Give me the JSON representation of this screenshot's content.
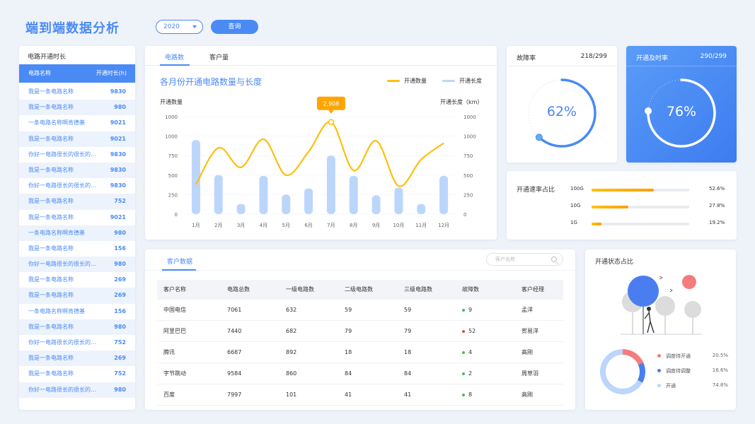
{
  "page": {
    "title": "端到端数据分析",
    "year": "2020",
    "query_label": "查询"
  },
  "left_panel": {
    "title": "电路开通时长",
    "col_name": "电路名称",
    "col_value": "开通时长(h)",
    "rows": [
      {
        "name": "我是一条电路名称",
        "value": "9830"
      },
      {
        "name": "我是一条电路名称",
        "value": "980"
      },
      {
        "name": "一条电路名称啊肯德基",
        "value": "9021"
      },
      {
        "name": "我是一条电路名称",
        "value": "9021"
      },
      {
        "name": "你好一电路很长的很长的...",
        "value": "9830"
      },
      {
        "name": "我是一条电路名称",
        "value": "9830"
      },
      {
        "name": "你好一电路很长的很长的...",
        "value": "9830"
      },
      {
        "name": "我是一条电路名称",
        "value": "752"
      },
      {
        "name": "我是一条电路名称",
        "value": "9021"
      },
      {
        "name": "一条电路名称啊肯德基",
        "value": "980"
      },
      {
        "name": "我是一条电路名称",
        "value": "156"
      },
      {
        "name": "你好一电路很长的很长的...",
        "value": "980"
      },
      {
        "name": "我是一条电路名称",
        "value": "269"
      },
      {
        "name": "我是一条电路名称",
        "value": "269"
      },
      {
        "name": "一条电路名称啊肯德基",
        "value": "156"
      },
      {
        "name": "我是一条电路名称",
        "value": "980"
      },
      {
        "name": "你好一电路很长的很长的...",
        "value": "752"
      },
      {
        "name": "我是一条电路名称",
        "value": "269"
      },
      {
        "name": "我是一条电路名称",
        "value": "752"
      },
      {
        "name": "你好一电路很长的很长的...",
        "value": "980"
      }
    ]
  },
  "chart_card": {
    "tabs": [
      "电路数",
      "客户量"
    ],
    "title": "各月份开通电路数量与长度",
    "legend_line": "开通数量",
    "legend_bar": "开通长度",
    "y_left_label": "开通数量",
    "y_right_label": "开通长度（km）",
    "tooltip": "2,908",
    "colors": {
      "line": "#ffbe0b",
      "bar": "#bcd6fb",
      "tooltip": "#ffa500"
    }
  },
  "chart_data": {
    "type": "bar",
    "categories": [
      "1月",
      "2月",
      "3月",
      "4月",
      "5月",
      "6月",
      "7月",
      "8月",
      "9月",
      "10月",
      "11月",
      "12月"
    ],
    "y_ticks_left": [
      "1000",
      "1000",
      "750",
      "500",
      "250",
      "0"
    ],
    "y_ticks_right": [
      "1000",
      "1000",
      "750",
      "500",
      "250",
      "0"
    ],
    "ylim": [
      0,
      1250
    ],
    "series": [
      {
        "name": "开通长度",
        "type": "bar",
        "values": [
          950,
          500,
          130,
          490,
          250,
          330,
          750,
          490,
          240,
          340,
          130,
          490
        ]
      },
      {
        "name": "开通数量",
        "type": "line",
        "values": [
          380,
          850,
          600,
          960,
          500,
          800,
          1180,
          560,
          940,
          360,
          700,
          910
        ]
      }
    ]
  },
  "gauge_fault": {
    "title": "故障率",
    "ratio": "218/299",
    "percent": "62%",
    "value": 0.62
  },
  "gauge_timely": {
    "title": "开通及时率",
    "ratio": "290/299",
    "percent": "76%",
    "value": 0.76
  },
  "rate_card": {
    "title": "开通速率占比",
    "rows": [
      {
        "label": "100G",
        "percent": "52.6%",
        "value": 0.64
      },
      {
        "label": "10G",
        "percent": "27.8%",
        "value": 0.38
      },
      {
        "label": "1G",
        "percent": "19.2%",
        "value": 0.1
      }
    ]
  },
  "customer_card": {
    "title": "客户数据",
    "search_placeholder": "客户名称",
    "columns": [
      "客户名称",
      "电路总数",
      "一级电路数",
      "二级电路数",
      "三级电路数",
      "故障数",
      "客户经理"
    ],
    "rows": [
      {
        "name": "中国电信",
        "total": "7061",
        "l1": "632",
        "l2": "59",
        "l3": "59",
        "fault": "9",
        "fault_color": "#3fbf5a",
        "manager": "孟洋"
      },
      {
        "name": "阿里巴巴",
        "total": "7440",
        "l1": "682",
        "l2": "79",
        "l3": "79",
        "fault": "52",
        "fault_color": "#f0483e",
        "manager": "贺易洋"
      },
      {
        "name": "腾讯",
        "total": "6687",
        "l1": "892",
        "l2": "18",
        "l3": "18",
        "fault": "4",
        "fault_color": "#3fbf5a",
        "manager": "高刚"
      },
      {
        "name": "字节跳动",
        "total": "9584",
        "l1": "860",
        "l2": "84",
        "l3": "84",
        "fault": "2",
        "fault_color": "#3fbf5a",
        "manager": "周草羽"
      },
      {
        "name": "百度",
        "total": "7997",
        "l1": "101",
        "l2": "41",
        "l3": "41",
        "fault": "8",
        "fault_color": "#3fbf5a",
        "manager": "高刚"
      }
    ]
  },
  "status_card": {
    "title": "开通状态占比",
    "items": [
      {
        "label": "调度待开通",
        "percent": "20.5%",
        "value": 0.205,
        "color": "#f47c7c"
      },
      {
        "label": "调度待调整",
        "percent": "16.6%",
        "value": 0.166,
        "color": "#4a7ef0"
      },
      {
        "label": "开通",
        "percent": "74.8%",
        "value": 0.748,
        "color": "#bcd6fb"
      }
    ]
  }
}
